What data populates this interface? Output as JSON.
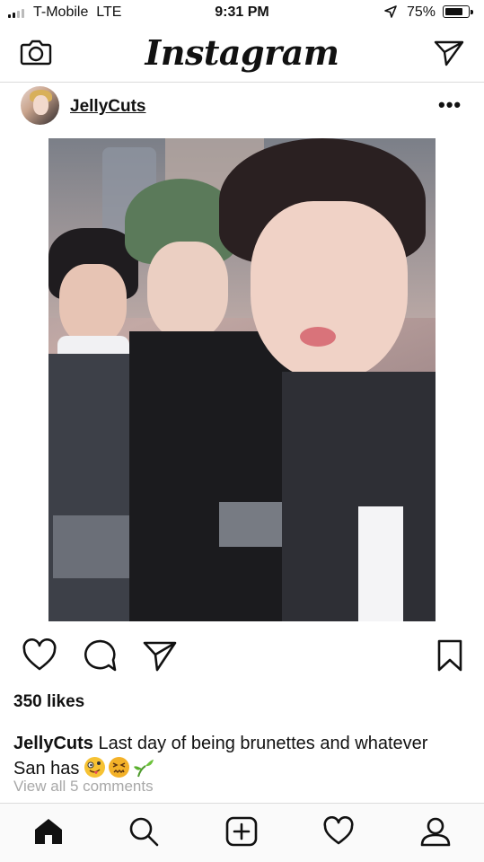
{
  "status_bar": {
    "carrier": "T-Mobile",
    "network": "LTE",
    "time": "9:31 PM",
    "battery_percent": "75%",
    "battery_level": 0.75,
    "icons": [
      "signal-icon",
      "location-arrow-icon",
      "battery-icon"
    ]
  },
  "header": {
    "logo_text": "Instagram",
    "left_icon": "camera-icon",
    "right_icon": "direct-message-icon"
  },
  "post": {
    "username": "JellyCuts",
    "more_icon": "more-options-icon",
    "more_glyph": "•••",
    "photo_icon": "post-photo",
    "likes": "350 likes",
    "caption_username": "JellyCuts",
    "caption_text": "Last day of being brunettes and whatever San has",
    "caption_emojis": [
      "zany-face-emoji",
      "confounded-face-emoji",
      "seedling-emoji"
    ],
    "view_comments": "View all 5 comments"
  },
  "actions": [
    "heart-icon",
    "comment-icon",
    "share-icon",
    "bookmark-icon"
  ],
  "bottom_nav": [
    "home-icon",
    "search-icon",
    "new-post-icon",
    "activity-heart-icon",
    "profile-icon"
  ],
  "colors": {
    "text": "#111111",
    "muted": "#a8a8a8",
    "divider": "#dbdbdb",
    "nav_background": "#fafafa"
  }
}
